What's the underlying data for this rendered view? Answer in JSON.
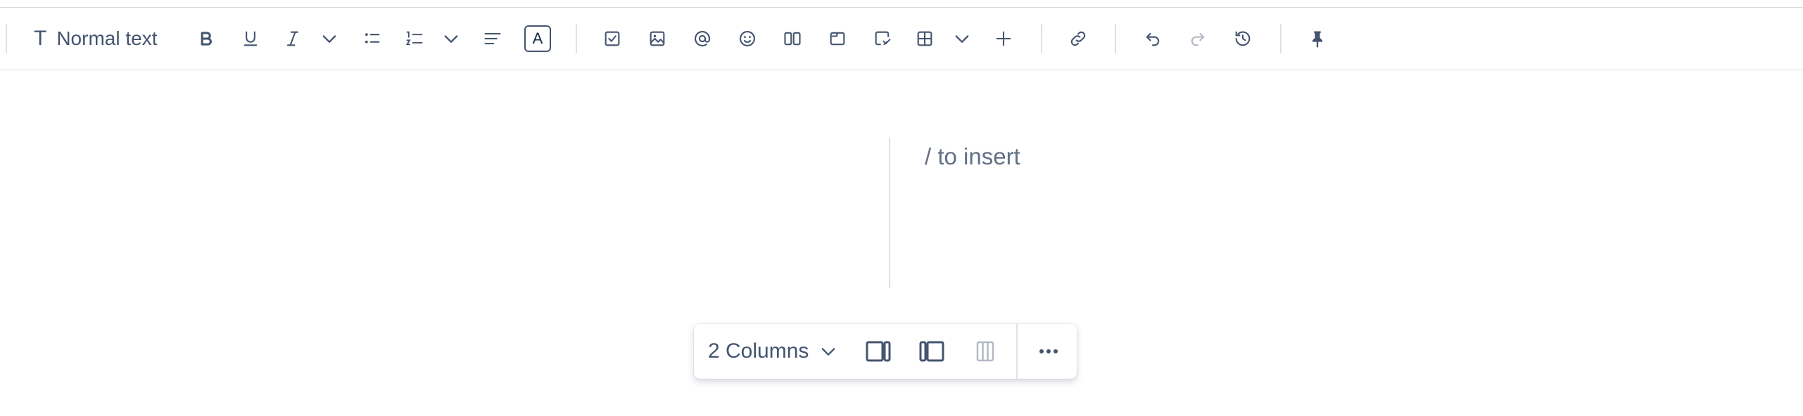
{
  "toolbar": {
    "text_style": {
      "glyph": "T",
      "label": "Normal text"
    },
    "text_color_letter": "A",
    "icons": {
      "bold": "bold-icon",
      "underline": "underline-icon",
      "italic": "italic-icon",
      "more_formatting": "chevron-down-icon",
      "bullet_list": "bullet-list-icon",
      "numbered_list": "numbered-list-icon",
      "list_options": "chevron-down-icon",
      "alignment": "align-left-icon",
      "text_color": "text-color-icon",
      "action_item": "checkbox-icon",
      "image": "image-icon",
      "mention": "mention-icon",
      "emoji": "emoji-icon",
      "layouts": "columns-icon",
      "expand": "expand-icon",
      "smart_link": "smart-link-icon",
      "table": "table-icon",
      "table_options": "chevron-down-icon",
      "insert": "plus-icon",
      "link": "link-icon",
      "undo": "undo-icon",
      "redo": "redo-icon",
      "history": "history-icon",
      "pin": "pin-icon"
    }
  },
  "editor": {
    "placeholder": "/ to insert"
  },
  "layout_toolbar": {
    "columns_label": "2 Columns",
    "icons": {
      "dropdown": "chevron-down-icon",
      "right_sidebar": "layout-right-sidebar-icon",
      "left_sidebar": "layout-left-sidebar-icon",
      "three_columns": "layout-three-columns-icon",
      "more": "more-icon"
    }
  },
  "colors": {
    "icon": "#44546f",
    "icon_disabled": "#b3b9c4",
    "separator": "#dfe1e6",
    "placeholder": "#626f86"
  }
}
